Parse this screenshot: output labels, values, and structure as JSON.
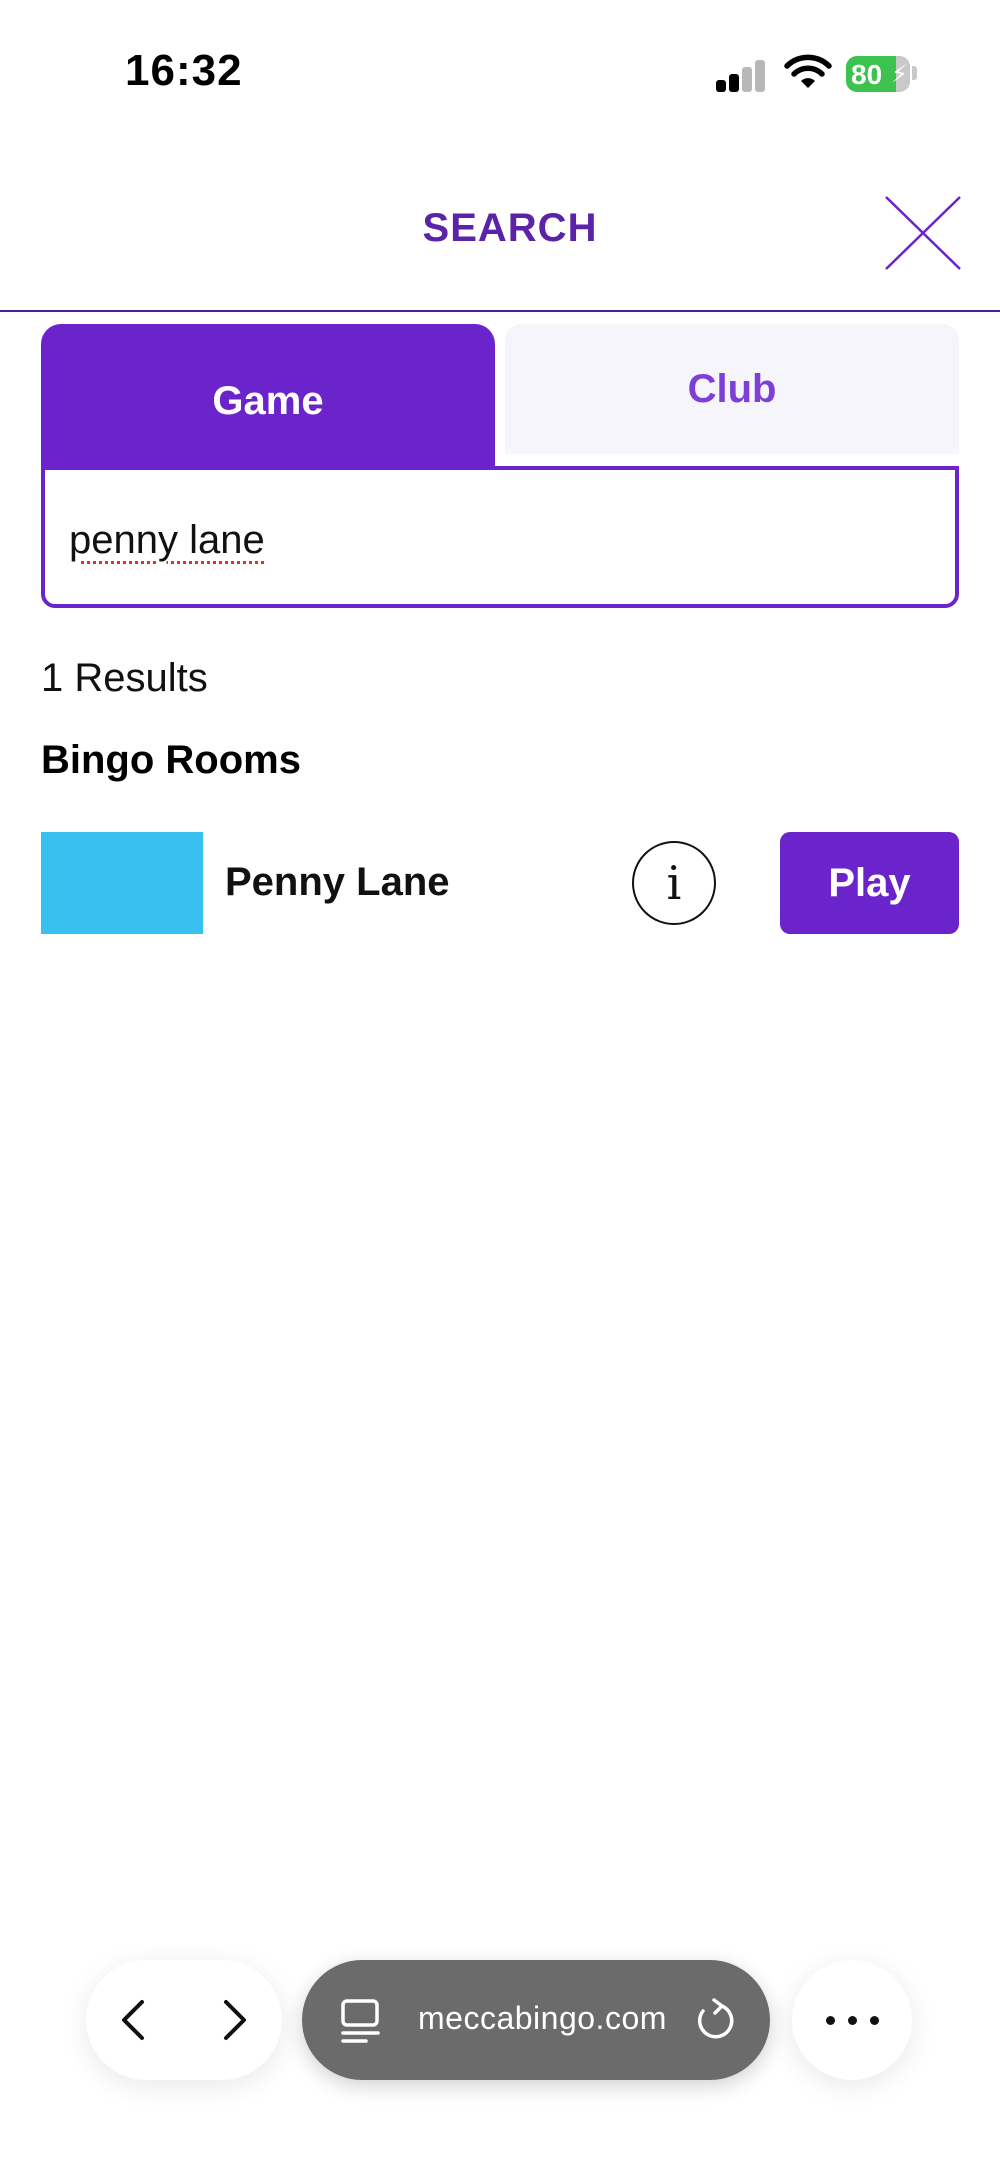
{
  "status_bar": {
    "time": "16:32",
    "battery_percent": "80"
  },
  "header": {
    "title": "SEARCH",
    "close_icon": "close-icon"
  },
  "tabs": [
    {
      "label": "Game",
      "active": true
    },
    {
      "label": "Club",
      "active": false
    }
  ],
  "search": {
    "value": "penny lane"
  },
  "results": {
    "count_label": "1 Results",
    "section_title": "Bingo Rooms",
    "items": [
      {
        "name": "Penny Lane",
        "thumbnail_color": "#38c1f0",
        "play_label": "Play",
        "info_icon": "info-icon"
      }
    ]
  },
  "browser": {
    "url": "meccabingo.com",
    "icons": [
      "back-icon",
      "forward-icon",
      "tabs-icon",
      "reload-icon",
      "more-icon"
    ]
  },
  "colors": {
    "brand": "#6b24cc",
    "title": "#5a23a8",
    "tab_inactive_bg": "#f6f5fb"
  }
}
